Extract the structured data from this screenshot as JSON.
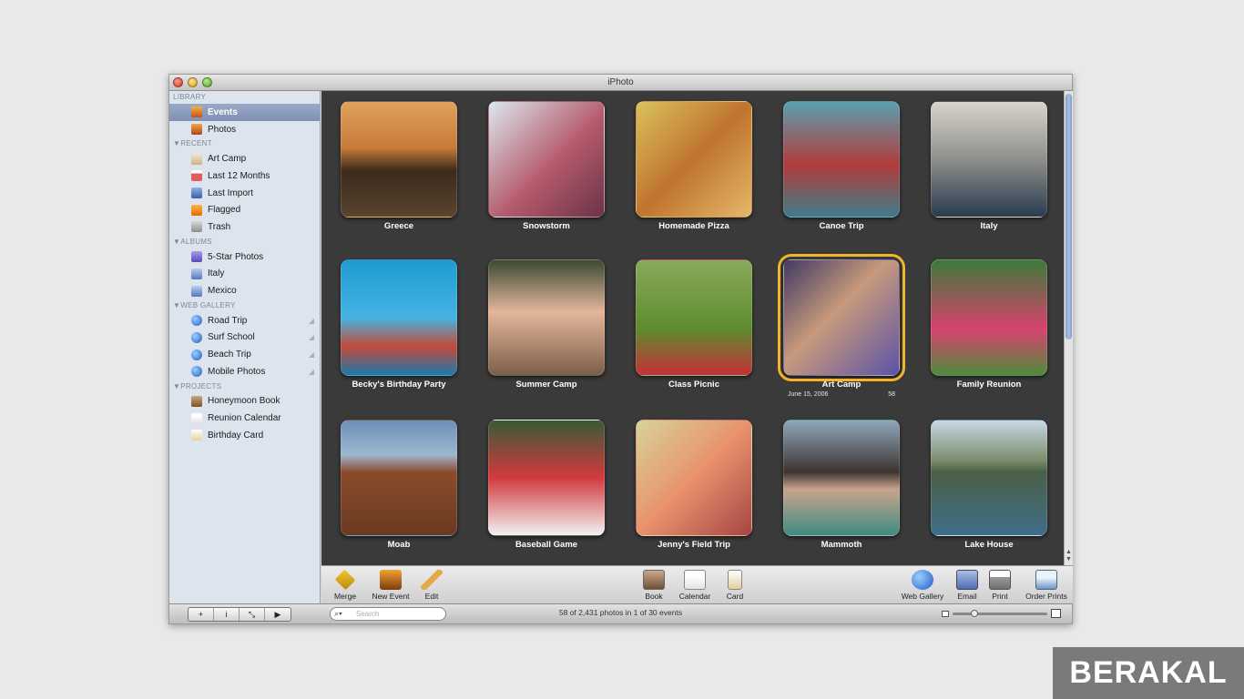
{
  "window": {
    "title": "iPhoto"
  },
  "sidebar": {
    "sections": [
      {
        "heading": "LIBRARY",
        "items": [
          {
            "label": "Events",
            "icon": "events-icon",
            "selected": true
          },
          {
            "label": "Photos",
            "icon": "photos-icon"
          }
        ]
      },
      {
        "heading": "▼RECENT",
        "items": [
          {
            "label": "Art Camp",
            "icon": "event-icon"
          },
          {
            "label": "Last 12 Months",
            "icon": "calendar-icon"
          },
          {
            "label": "Last Import",
            "icon": "import-icon"
          },
          {
            "label": "Flagged",
            "icon": "flag-icon"
          },
          {
            "label": "Trash",
            "icon": "trash-icon"
          }
        ]
      },
      {
        "heading": "▼ALBUMS",
        "items": [
          {
            "label": "5-Star Photos",
            "icon": "smart-album-icon"
          },
          {
            "label": "Italy",
            "icon": "album-icon"
          },
          {
            "label": "Mexico",
            "icon": "album-icon"
          }
        ]
      },
      {
        "heading": "▼WEB GALLERY",
        "items": [
          {
            "label": "Road Trip",
            "icon": "globe-icon"
          },
          {
            "label": "Surf School",
            "icon": "globe-icon"
          },
          {
            "label": "Beach Trip",
            "icon": "globe-icon"
          },
          {
            "label": "Mobile Photos",
            "icon": "globe-icon"
          }
        ]
      },
      {
        "heading": "▼PROJECTS",
        "items": [
          {
            "label": "Honeymoon Book",
            "icon": "book-icon"
          },
          {
            "label": "Reunion Calendar",
            "icon": "calendar-project-icon"
          },
          {
            "label": "Birthday Card",
            "icon": "card-icon"
          }
        ]
      }
    ]
  },
  "events": [
    {
      "title": "Greece"
    },
    {
      "title": "Snowstorm"
    },
    {
      "title": "Homemade Pizza"
    },
    {
      "title": "Canoe Trip"
    },
    {
      "title": "Italy"
    },
    {
      "title": "Becky's Birthday Party"
    },
    {
      "title": "Summer Camp"
    },
    {
      "title": "Class Picnic"
    },
    {
      "title": "Art Camp",
      "date": "June 15, 2006",
      "count": "58",
      "selected": true
    },
    {
      "title": "Family Reunion"
    },
    {
      "title": "Moab"
    },
    {
      "title": "Baseball Game"
    },
    {
      "title": "Jenny's Field Trip"
    },
    {
      "title": "Mammoth"
    },
    {
      "title": "Lake House"
    }
  ],
  "toolbar": {
    "merge": "Merge",
    "new_event": "New Event",
    "edit": "Edit",
    "book": "Book",
    "calendar": "Calendar",
    "card": "Card",
    "web_gallery": "Web Gallery",
    "email": "Email",
    "print": "Print",
    "order_prints": "Order Prints"
  },
  "statusbar": {
    "add": "+",
    "info": "i",
    "fullscreen": "⤡",
    "play": "▶",
    "search_placeholder": "Search",
    "status": "58 of 2,431 photos in 1 of 30 events"
  },
  "watermark": "BERAKAL"
}
